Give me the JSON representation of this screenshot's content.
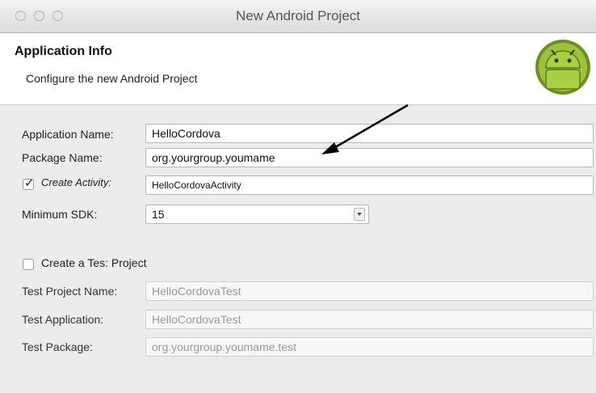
{
  "window": {
    "title": "New Android Project"
  },
  "header": {
    "title": "Application Info",
    "subtitle": "Configure the new Android Project"
  },
  "form": {
    "app_name": {
      "label": "Application Name:",
      "value": "HelloCordova"
    },
    "package_name": {
      "label": "Package Name:",
      "value": "org.yourgroup.youmame"
    },
    "create_activity": {
      "label": "Create Activity:",
      "value": "HelloCordovaActivity",
      "checked": true
    },
    "min_sdk": {
      "label": "Minimum SDK:",
      "value": "15"
    },
    "create_test": {
      "label": "Create a Tes: Project",
      "checked": false
    },
    "test_project_name": {
      "label": "Test Project Name:",
      "value": "HelloCordovaTest"
    },
    "test_application": {
      "label": "Test Application:",
      "value": "HelloCordovaTest"
    },
    "test_package": {
      "label": "Test Package:",
      "value": "org.yourgroup.youmame.test"
    }
  },
  "icons": {
    "logo": "android-logo-icon",
    "annotation": "annotation-arrow"
  },
  "colors": {
    "android_green": "#9ac23c",
    "field_border": "#b7b7b7"
  }
}
